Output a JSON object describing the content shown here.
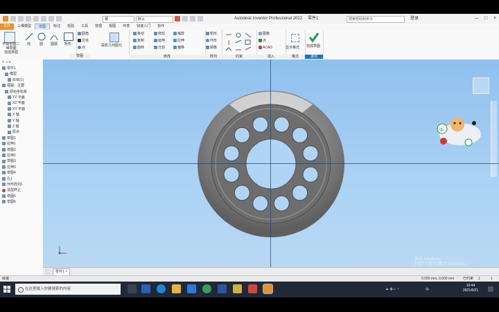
{
  "app": {
    "title": "Autodesk Inventor Professional 2022",
    "doc_title": "零件1",
    "search_placeholder": "搜索帮助和命令...",
    "user": "登录",
    "combo_material": "钢",
    "combo_appearance": "默认"
  },
  "tabs": [
    "文件",
    "三维模型",
    "草图",
    "标注",
    "检验",
    "工具",
    "管理",
    "视图",
    "环境",
    "快速入门",
    "协作"
  ],
  "ribbon": {
    "groups": [
      {
        "label": "草图",
        "items": [
          "开始创建二维草图",
          "完成草图",
          "线",
          "圆",
          "圆弧",
          "矩形",
          "圆角",
          "文本",
          "点"
        ]
      },
      {
        "label": "绘制",
        "items": [
          "投影几何图元"
        ]
      },
      {
        "label": "修改",
        "items": [
          "移动",
          "修剪",
          "复制",
          "延伸",
          "旋转",
          "分割",
          "缩放",
          "拉伸",
          "偏移"
        ]
      },
      {
        "label": "阵列",
        "items": [
          "矩形",
          "环形",
          "镜像"
        ]
      },
      {
        "label": "约束",
        "items": []
      },
      {
        "label": "插入",
        "items": [
          "图像",
          "点",
          "ACAD"
        ]
      },
      {
        "label": "格式",
        "items": [
          "显示格式"
        ]
      },
      {
        "label": "退出",
        "items": [
          "完成草图"
        ]
      }
    ]
  },
  "tree": {
    "items": [
      "零件1",
      "模型",
      "实体(1)",
      "视图：主要",
      "原始坐标系",
      "YZ 平面",
      "XZ 平面",
      "XY 平面",
      "X 轴",
      "Y 轴",
      "Z 轴",
      "原点",
      "草图1",
      "拉伸1",
      "草图2",
      "拉伸2",
      "草图3",
      "拉伸3",
      "草图4",
      "孔1",
      "环形阵列1",
      "造型终止",
      "草图5",
      "草图6"
    ]
  },
  "doc_tab": "零件1",
  "status": {
    "left": "就绪",
    "coords": "0.000 mm, 0.000 mm",
    "right": "已约束",
    "count": "1",
    "count2": "1"
  },
  "taskbar": {
    "search": "在这里输入你要搜索的内容",
    "tray_text": "中",
    "time": "10:44",
    "date": "2021/6/21"
  },
  "watermark": {
    "line1": "激活 Windows",
    "line2": "转到\"设置\"以激活 Windows。"
  },
  "sticker_text": "中",
  "colors": {
    "file_tab": "#e8902f",
    "accent": "#1a74c9",
    "viewport_top": "#8fc0ee",
    "part_body": "#808080",
    "taskbar": "#1f2937"
  }
}
